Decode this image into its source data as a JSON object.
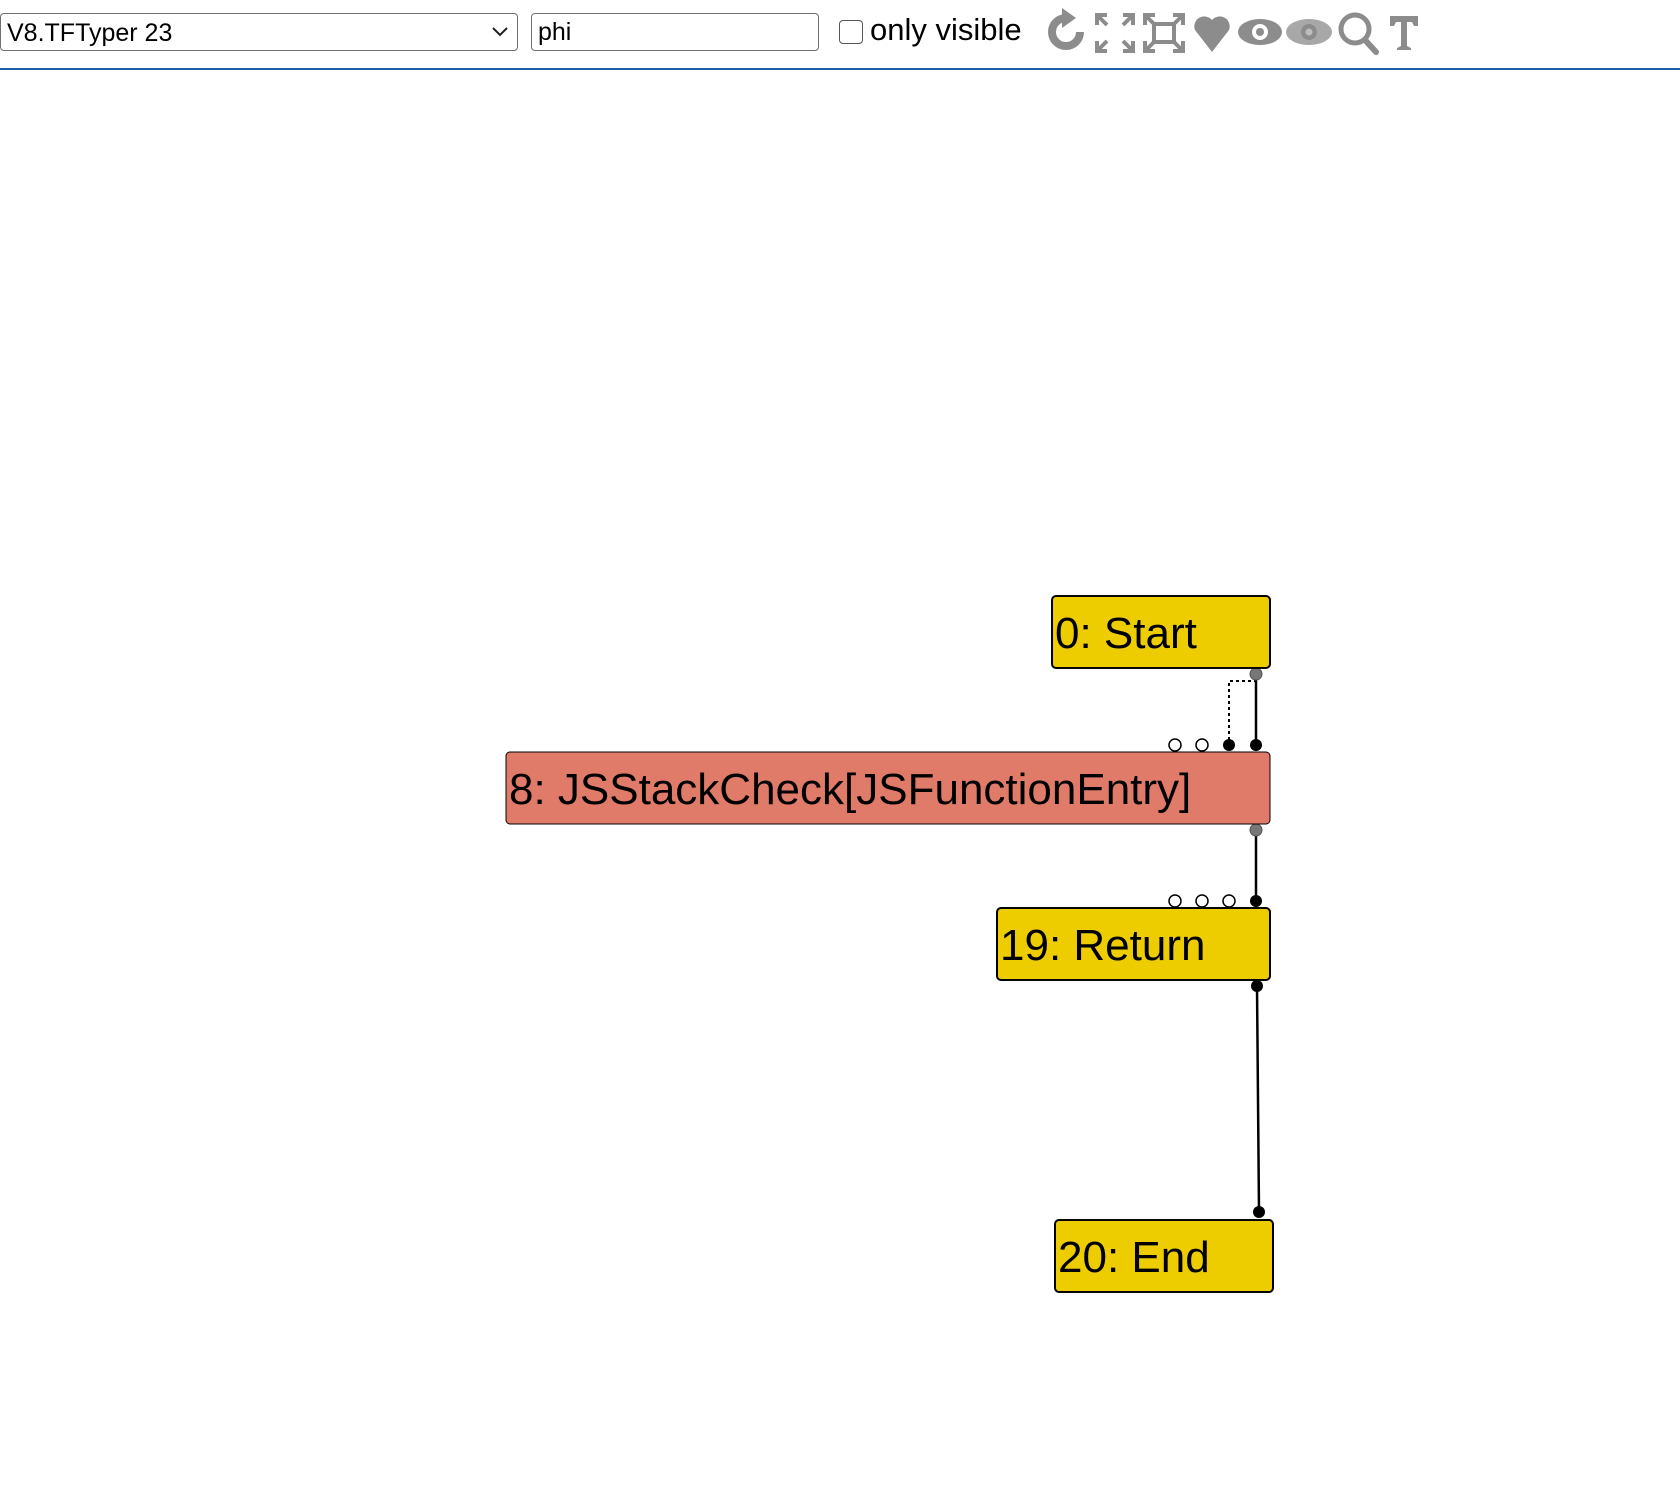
{
  "toolbar": {
    "phase_select_value": "V8.TFTyper 23",
    "search_value": "phi",
    "only_visible_label": "only visible",
    "only_visible_checked": false,
    "icons": [
      "refresh-icon",
      "layout-all-icon",
      "layout-selected-icon",
      "toggle-types-icon",
      "show-all-icon",
      "hide-unselected-icon",
      "zoom-selection-icon",
      "toggle-types-text-icon"
    ]
  },
  "graph": {
    "nodes": [
      {
        "id": "node-0",
        "label": "0: Start",
        "color": "#eecd00"
      },
      {
        "id": "node-8",
        "label": "8: JSStackCheck[JSFunctionEntry]",
        "color": "#e07b6a"
      },
      {
        "id": "node-19",
        "label": "19: Return",
        "color": "#eecd00"
      },
      {
        "id": "node-20",
        "label": "20: End",
        "color": "#eecd00"
      }
    ]
  },
  "colors": {
    "control_node": "#eecd00",
    "effect_node": "#e07b6a",
    "toolbar_icon": "#8c8c8c",
    "toolbar_border": "#1a5fa8"
  }
}
